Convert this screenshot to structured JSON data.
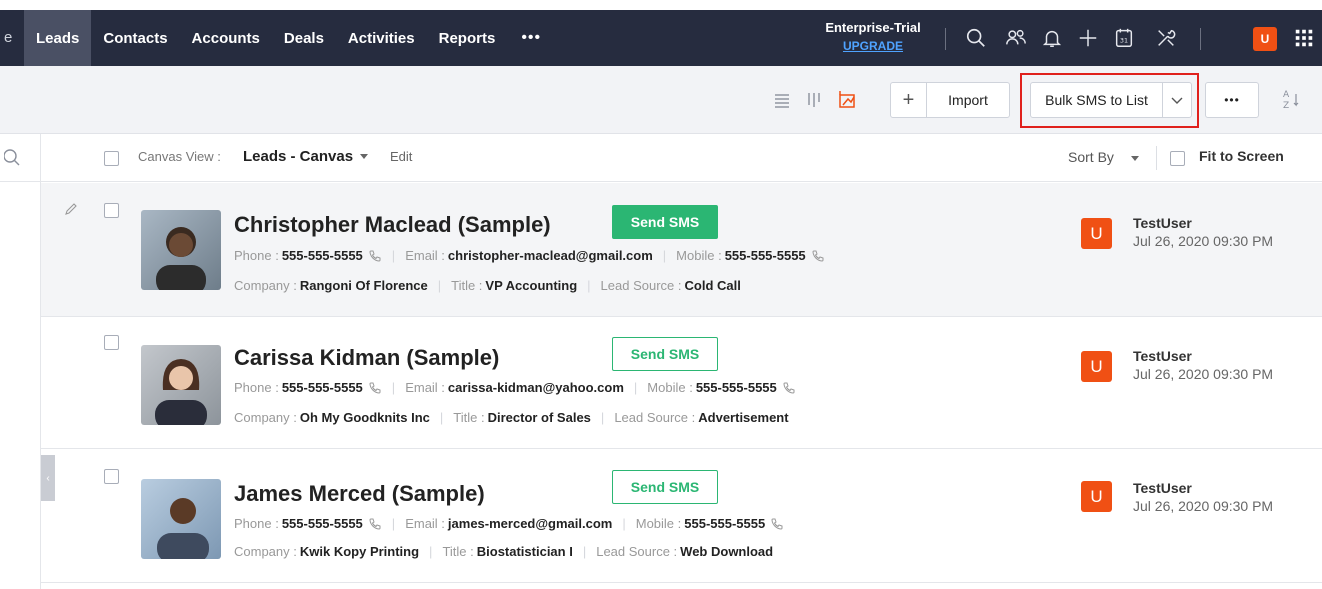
{
  "nav": {
    "tabs": [
      "Leads",
      "Contacts",
      "Accounts",
      "Deals",
      "Activities",
      "Reports"
    ],
    "more": "•••",
    "trial_label": "Enterprise-Trial",
    "upgrade_label": "UPGRADE",
    "avatar_initial": "U",
    "icons": [
      "search-icon",
      "contacts-icon",
      "bell-icon",
      "plus-icon",
      "calendar-icon",
      "tools-icon",
      "apps-grid-icon"
    ]
  },
  "toolbar": {
    "import_label": "Import",
    "bulk_sms_label": "Bulk SMS to List",
    "more_label": "•••",
    "add_symbol": "+"
  },
  "canvas": {
    "view_prefix": "Canvas View :",
    "view_name": "Leads - Canvas",
    "edit_label": "Edit",
    "sort_label": "Sort By",
    "fit_label": "Fit to Screen"
  },
  "labels": {
    "phone": "Phone :",
    "email": "Email :",
    "mobile": "Mobile :",
    "company": "Company :",
    "title": "Title :",
    "lead_source": "Lead Source :",
    "send_sms": "Send SMS"
  },
  "leads": [
    {
      "name": "Christopher Maclead (Sample)",
      "phone": "555-555-5555",
      "email": "christopher-maclead@gmail.com",
      "mobile": "555-555-5555",
      "company": "Rangoni Of Florence",
      "title": "VP Accounting",
      "lead_source": "Cold Call",
      "owner_initial": "U",
      "owner": "TestUser",
      "date": "Jul 26, 2020 09:30 PM"
    },
    {
      "name": "Carissa Kidman (Sample)",
      "phone": "555-555-5555",
      "email": "carissa-kidman@yahoo.com",
      "mobile": "555-555-5555",
      "company": "Oh My Goodknits Inc",
      "title": "Director of Sales",
      "lead_source": "Advertisement",
      "owner_initial": "U",
      "owner": "TestUser",
      "date": "Jul 26, 2020 09:30 PM"
    },
    {
      "name": "James Merced (Sample)",
      "phone": "555-555-5555",
      "email": "james-merced@gmail.com",
      "mobile": "555-555-5555",
      "company": "Kwik Kopy Printing",
      "title": "Biostatistician I",
      "lead_source": "Web Download",
      "owner_initial": "U",
      "owner": "TestUser",
      "date": "Jul 26, 2020 09:30 PM"
    }
  ],
  "colors": {
    "nav_bg": "#262c3f",
    "accent_orange": "#f05014",
    "sms_green": "#2bb673",
    "highlight_red": "#e0201c",
    "upgrade_blue": "#4fa3ff"
  }
}
